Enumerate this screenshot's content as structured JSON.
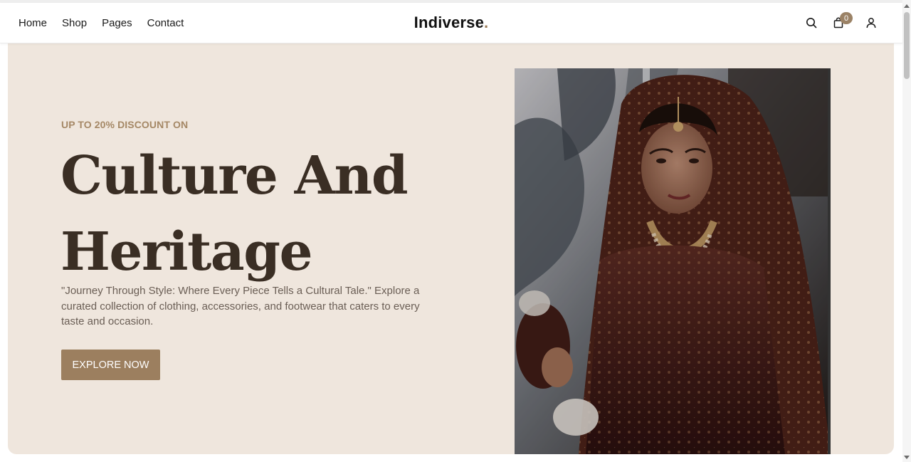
{
  "nav": {
    "items": [
      {
        "label": "Home"
      },
      {
        "label": "Shop"
      },
      {
        "label": "Pages"
      },
      {
        "label": "Contact"
      }
    ]
  },
  "brand": {
    "name": "Indiverse",
    "dot": "."
  },
  "header_icons": {
    "search": "search-icon",
    "cart": "shopping-bag-icon",
    "cart_count": "0",
    "account": "user-icon"
  },
  "hero": {
    "eyebrow": "UP TO 20% DISCOUNT ON",
    "headline_line1": "Culture And",
    "headline_line2": "Heritage",
    "description": "\"Journey Through Style: Where Every Piece Tells a Cultural Tale.\" Explore a curated collection of clothing, accessories, and footwear that caters to every taste and occasion.",
    "cta_label": "EXPLORE NOW"
  },
  "colors": {
    "accent": "#9c7f5f",
    "hero_background": "#efe6dd",
    "headline": "#3a2e24"
  }
}
